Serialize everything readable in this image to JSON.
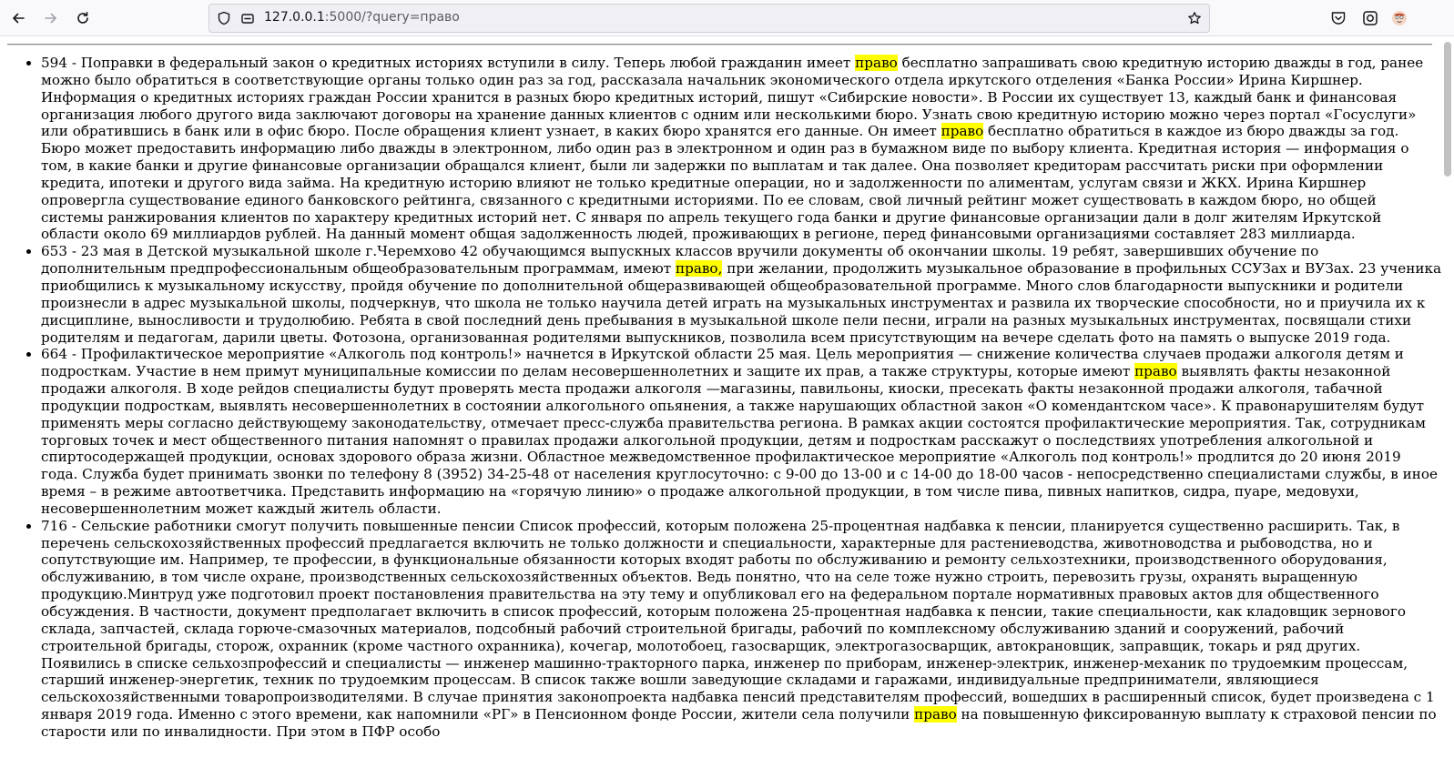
{
  "browser": {
    "url_host": "127.0.0.1",
    "url_rest": ":5000/?query=право",
    "icons": [
      "back-icon",
      "forward-icon",
      "reload-icon",
      "shield-icon",
      "lock-icon",
      "bookmark-star-icon",
      "pocket-icon",
      "extension-icon",
      "profile-icon"
    ]
  },
  "colors": {
    "highlight": "#ffff00"
  },
  "results": [
    {
      "parts": [
        "594 - Поправки в федеральный закон о кредитных историях вступили в силу. Теперь любой гражданин имеет ",
        "право",
        " бесплатно запрашивать свою кредитную историю дважды в год, ранее можно было обратиться в соответствующие органы только один раз за год, рассказала начальник экономического отдела иркутского отделения «Банка России» Ирина Киршнер. Информация о кредитных историях граждан России хранится в разных бюро кредитных историй, пишут «Сибирские новости». В России их существует 13, каждый банк и финансовая организация любого другого вида заключают договоры на хранение данных клиентов с одним или несколькими бюро. Узнать свою кредитную историю можно через портал «Госуслуги» или обратившись в банк или в офис бюро. После обращения клиент узнает, в каких бюро хранятся его данные. Он имеет ",
        "право",
        " бесплатно обратиться в каждое из бюро дважды за год. Бюро может предоставить информацию либо дважды в электронном, либо один раз в электронном и один раз в бумажном виде по выбору клиента. Кредитная история — информация о том, в какие банки и другие финансовые организации обращался клиент, были ли задержки по выплатам и так далее. Она позволяет кредиторам рассчитать риски при оформлении кредита, ипотеки и другого вида займа. На кредитную историю влияют не только кредитные операции, но и задолженности по алиментам, услугам связи и ЖКХ. Ирина Киршнер опровергла существование единого банковского рейтинга, связанного с кредитными историями. По ее словам, свой личный рейтинг может существовать в каждом бюро, но общей системы ранжирования клиентов по характеру кредитных историй нет. С января по апрель текущего года банки и другие финансовые организации дали в долг жителям Иркутской области около 69 миллиардов рублей. На данный момент общая задолженность людей, проживающих в регионе, перед финансовыми организациями составляет 283 миллиарда."
      ]
    },
    {
      "parts": [
        "653 - 23 мая в Детской музыкальной школе г.Черемхово 42 обучающимся выпускных классов вручили документы об окончании школы. 19 ребят, завершивших обучение по дополнительным предпрофессиональным общеобразовательным программам, имеют ",
        "право,",
        " при желании, продолжить музыкальное образование в профильных ССУЗах и ВУЗах. 23 ученика приобщились к музыкальному искусству, пройдя обучение по дополнительной общеразвивающей общеобразовательной программе. Много слов благодарности выпускники и родители произнесли в адрес музыкальной школы, подчеркнув, что школа не только научила детей играть на музыкальных инструментах и развила их творческие способности, но и приучила их к дисциплине, выносливости и трудолюбию. Ребята в свой последний день пребывания в музыкальной школе пели песни, играли на разных музыкальных инструментах, посвящали стихи родителям и педагогам, дарили цветы. Фотозона, организованная родителями выпускников, позволила всем присутствующим на вечере сделать фото на память о выпуске 2019 года."
      ]
    },
    {
      "parts": [
        "664 - Профилактическое мероприятие «Алкоголь под контроль!» начнется в Иркутской области 25 мая. Цель мероприятия — снижение количества случаев продажи алкоголя детям и подросткам. Участие в нем примут муниципальные комиссии по делам несовершеннолетних и защите их прав, а также структуры, которые имеют ",
        "право",
        " выявлять факты незаконной продажи алкоголя. В ходе рейдов специалисты будут проверять места продажи алкоголя —магазины, павильоны, киоски, пресекать факты незаконной продажи алкоголя, табачной продукции подросткам, выявлять несовершеннолетних в состоянии алкогольного опьянения, а также нарушающих областной закон «О комендантском часе». К правонарушителям будут применять меры согласно действующему законодательству, отмечает пресс-служба правительства региона. В рамках акции состоятся профилактические мероприятия. Так, сотрудникам торговых точек и мест общественного питания напомнят о правилах продажи алкогольной продукции, детям и подросткам расскажут о последствиях употребления алкогольной и спиртосодержащей продукции, основах здорового образа жизни. Областное межведомственное профилактическое мероприятие «Алкоголь под контроль!» продлится до 20 июня 2019 года. Служба будет принимать звонки по телефону 8 (3952) 34-25-48 от населения круглосуточно: с 9-00 до 13-00 и с 14-00 до 18-00 часов - непосредственно специалистами службы, в иное время – в режиме автоответчика. Представить информацию на «горячую линию» о продаже алкогольной продукции, в том числе пива, пивных напитков, сидра, пуаре, медовухи, несовершеннолетним может каждый житель области."
      ]
    },
    {
      "parts": [
        "716 - Сельские работники смогут получить повышенные пенсии Список профессий, которым положена 25-процентная надбавка к пенсии, планируется существенно расширить. Так, в перечень сельскохозяйственных профессий предлагается включить не только должности и специальности, характерные для растениеводства, животноводства и рыбоводства, но и сопутствующие им. Например, те профессии, в функциональные обязанности которых входят работы по обслуживанию и ремонту сельхозтехники, производственного оборудования, обслуживанию, в том числе охране, производственных сельскохозяйственных объектов. Ведь понятно, что на селе тоже нужно строить, перевозить грузы, охранять выращенную продукцию.Минтруд уже подготовил проект постановления правительства на эту тему и опубликовал его на федеральном портале нормативных правовых актов для общественного обсуждения. В частности, документ предполагает включить в список профессий, которым положена 25-процентная надбавка к пенсии, такие специальности, как кладовщик зернового склада, запчастей, склада горюче-смазочных материалов, подсобный рабочий строительной бригады, рабочий по комплексному обслуживанию зданий и сооружений, рабочий строительной бригады, сторож, охранник (кроме частного охранника), кочегар, молотобоец, газосварщик, электрогазосварщик, автокрановщик, заправщик, токарь и ряд других. Появились в списке сельхозпрофессий и специалисты — инженер машинно-тракторного парка, инженер по приборам, инженер-электрик, инженер-механик по трудоемким процессам, старший инженер-энергетик, техник по трудоемким процессам. В список также вошли заведующие складами и гаражами, индивидуальные предприниматели, являющиеся сельскохозяйственными товаропроизводителями. В случае принятия законопроекта надбавка пенсий представителям профессий, вошедших в расширенный список, будет произведена с 1 января 2019 года. Именно с этого времени, как напомнили «РГ» в Пенсионном фонде России, жители села получили ",
        "право",
        " на повышенную фиксированную выплату к страховой пенсии по старости или по инвалидности. При этом в ПФР особо"
      ]
    }
  ]
}
